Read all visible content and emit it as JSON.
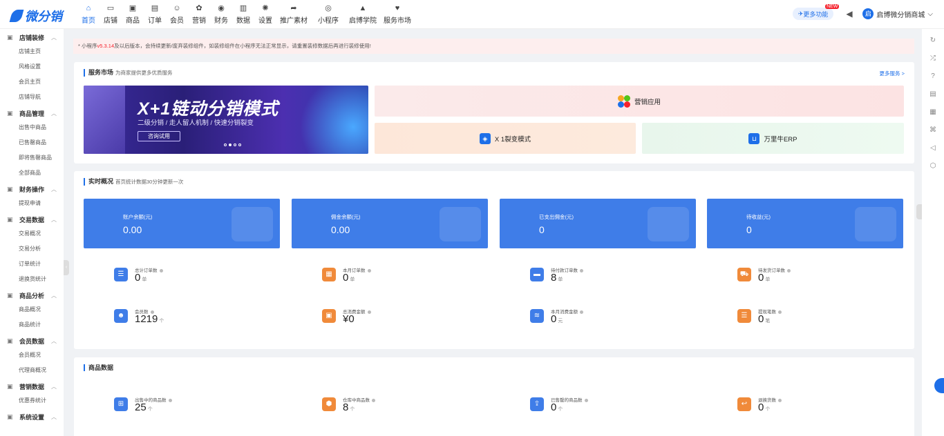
{
  "app": {
    "logo": "微分销"
  },
  "nav": [
    {
      "label": "首页",
      "icon": "home-icon"
    },
    {
      "label": "店铺",
      "icon": "shop-icon"
    },
    {
      "label": "商品",
      "icon": "goods-icon"
    },
    {
      "label": "订单",
      "icon": "order-icon"
    },
    {
      "label": "会员",
      "icon": "member-icon"
    },
    {
      "label": "营销",
      "icon": "marketing-icon"
    },
    {
      "label": "财务",
      "icon": "finance-icon"
    },
    {
      "label": "数据",
      "icon": "data-icon"
    },
    {
      "label": "设置",
      "icon": "settings-icon"
    },
    {
      "label": "推广素材",
      "icon": "share-icon"
    },
    {
      "label": "小程序",
      "icon": "miniprogram-icon"
    },
    {
      "label": "启博学院",
      "icon": "academy-icon"
    },
    {
      "label": "服务市场",
      "icon": "service-market-icon"
    }
  ],
  "topright": {
    "more": "更多功能",
    "new_tag": "NEW",
    "shop": "启博微分销商城"
  },
  "sidebar": [
    {
      "group": "店铺装修",
      "items": [
        "店铺主页",
        "风格设置",
        "会员主页",
        "店铺导航"
      ]
    },
    {
      "group": "商品管理",
      "items": [
        "出售中商品",
        "已售罄商品",
        "即将售罄商品",
        "全部商品"
      ]
    },
    {
      "group": "财务操作",
      "items": [
        "提现申请"
      ]
    },
    {
      "group": "交易数据",
      "items": [
        "交易概况",
        "交易分析",
        "订单统计",
        "退换货统计"
      ]
    },
    {
      "group": "商品分析",
      "items": [
        "商品概况",
        "商品统计"
      ]
    },
    {
      "group": "会员数据",
      "items": [
        "会员概况",
        "代理商概况"
      ]
    },
    {
      "group": "营销数据",
      "items": [
        "优惠券统计"
      ]
    },
    {
      "group": "系统设置",
      "items": []
    }
  ],
  "notice": {
    "prefix": "* 小程序",
    "version": "v5.3.14",
    "suffix": "及以后版本，会持续更新/废弃装修组件，如装修组件在小程序无法正常显示，请重置装修数据后再进行装修使用!"
  },
  "services": {
    "title": "服务市场",
    "subtitle": "为商家提供更多优质服务",
    "more": "更多服务 >",
    "banner": {
      "title": "X+1链动分销模式",
      "subtitle": "二级分销 / 走人留人机制 / 快速分销裂变",
      "button": "咨询试用",
      "slides": 4,
      "active": 1
    },
    "tiles": {
      "a": "营销应用",
      "b": "X 1裂变模式",
      "c": "万里牛ERP"
    }
  },
  "realtime": {
    "title": "实时概况",
    "subtitle": "首页统计数据30分钟更新一次",
    "stats": [
      {
        "label": "账户余额(元)",
        "value": "0.00"
      },
      {
        "label": "佣金余额(元)",
        "value": "0.00"
      },
      {
        "label": "已支出佣金(元)",
        "value": "0"
      },
      {
        "label": "待收益(元)",
        "value": "0"
      }
    ],
    "metrics": [
      {
        "label": "总计订单数",
        "value": "0",
        "unit": "单",
        "icon": "clipboard-icon",
        "color": "#3f7de8"
      },
      {
        "label": "本月订单数",
        "value": "0",
        "unit": "单",
        "icon": "calendar-icon",
        "color": "#f08a3a"
      },
      {
        "label": "待付款订单数",
        "value": "8",
        "unit": "单",
        "icon": "wallet-icon",
        "color": "#3f7de8"
      },
      {
        "label": "待发货订单数",
        "value": "0",
        "unit": "单",
        "icon": "truck-icon",
        "color": "#f08a3a"
      },
      {
        "label": "会员数",
        "value": "1219",
        "unit": "个",
        "icon": "users-icon",
        "color": "#3f7de8"
      },
      {
        "label": "总消费金额",
        "value": "¥0",
        "unit": "",
        "icon": "ticket-icon",
        "color": "#f08a3a"
      },
      {
        "label": "本月消费金额",
        "value": "0",
        "unit": "元",
        "icon": "coins-icon",
        "color": "#3f7de8"
      },
      {
        "label": "提现笔数",
        "value": "0",
        "unit": "笔",
        "icon": "withdraw-icon",
        "color": "#f08a3a"
      }
    ]
  },
  "goods": {
    "title": "商品数据",
    "metrics": [
      {
        "label": "出售中的商品数",
        "value": "25",
        "unit": "个",
        "icon": "cart-icon",
        "color": "#3f7de8"
      },
      {
        "label": "仓库中商品数",
        "value": "8",
        "unit": "个",
        "icon": "box-icon",
        "color": "#f08a3a"
      },
      {
        "label": "已售罄的商品数",
        "value": "0",
        "unit": "个",
        "icon": "upload-icon",
        "color": "#3f7de8"
      },
      {
        "label": "退换货数",
        "value": "0",
        "unit": "个",
        "icon": "return-icon",
        "color": "#f08a3a"
      }
    ]
  }
}
